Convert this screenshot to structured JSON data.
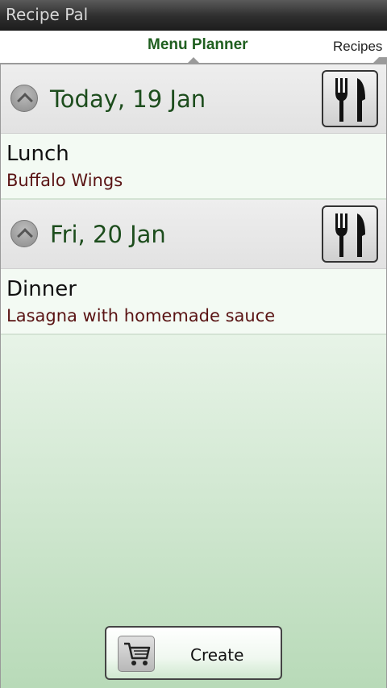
{
  "app": {
    "title": "Recipe Pal"
  },
  "tabs": {
    "active_label": "Menu Planner",
    "next_label": "Recipes"
  },
  "days": [
    {
      "label": "Today, 19 Jan",
      "meals": [
        {
          "type": "Lunch",
          "name": "Buffalo Wings"
        }
      ]
    },
    {
      "label": "Fri, 20 Jan",
      "meals": [
        {
          "type": "Dinner",
          "name": "Lasagna with homemade sauce"
        }
      ]
    }
  ],
  "footer": {
    "create_label": "Create"
  },
  "icons": {
    "collapse": "chevron-up-icon",
    "meal": "fork-knife-icon",
    "cart": "shopping-cart-icon"
  },
  "colors": {
    "day_label": "#1d4d1d",
    "meal_name": "#5a1414",
    "active_tab": "#1f5f1f"
  }
}
